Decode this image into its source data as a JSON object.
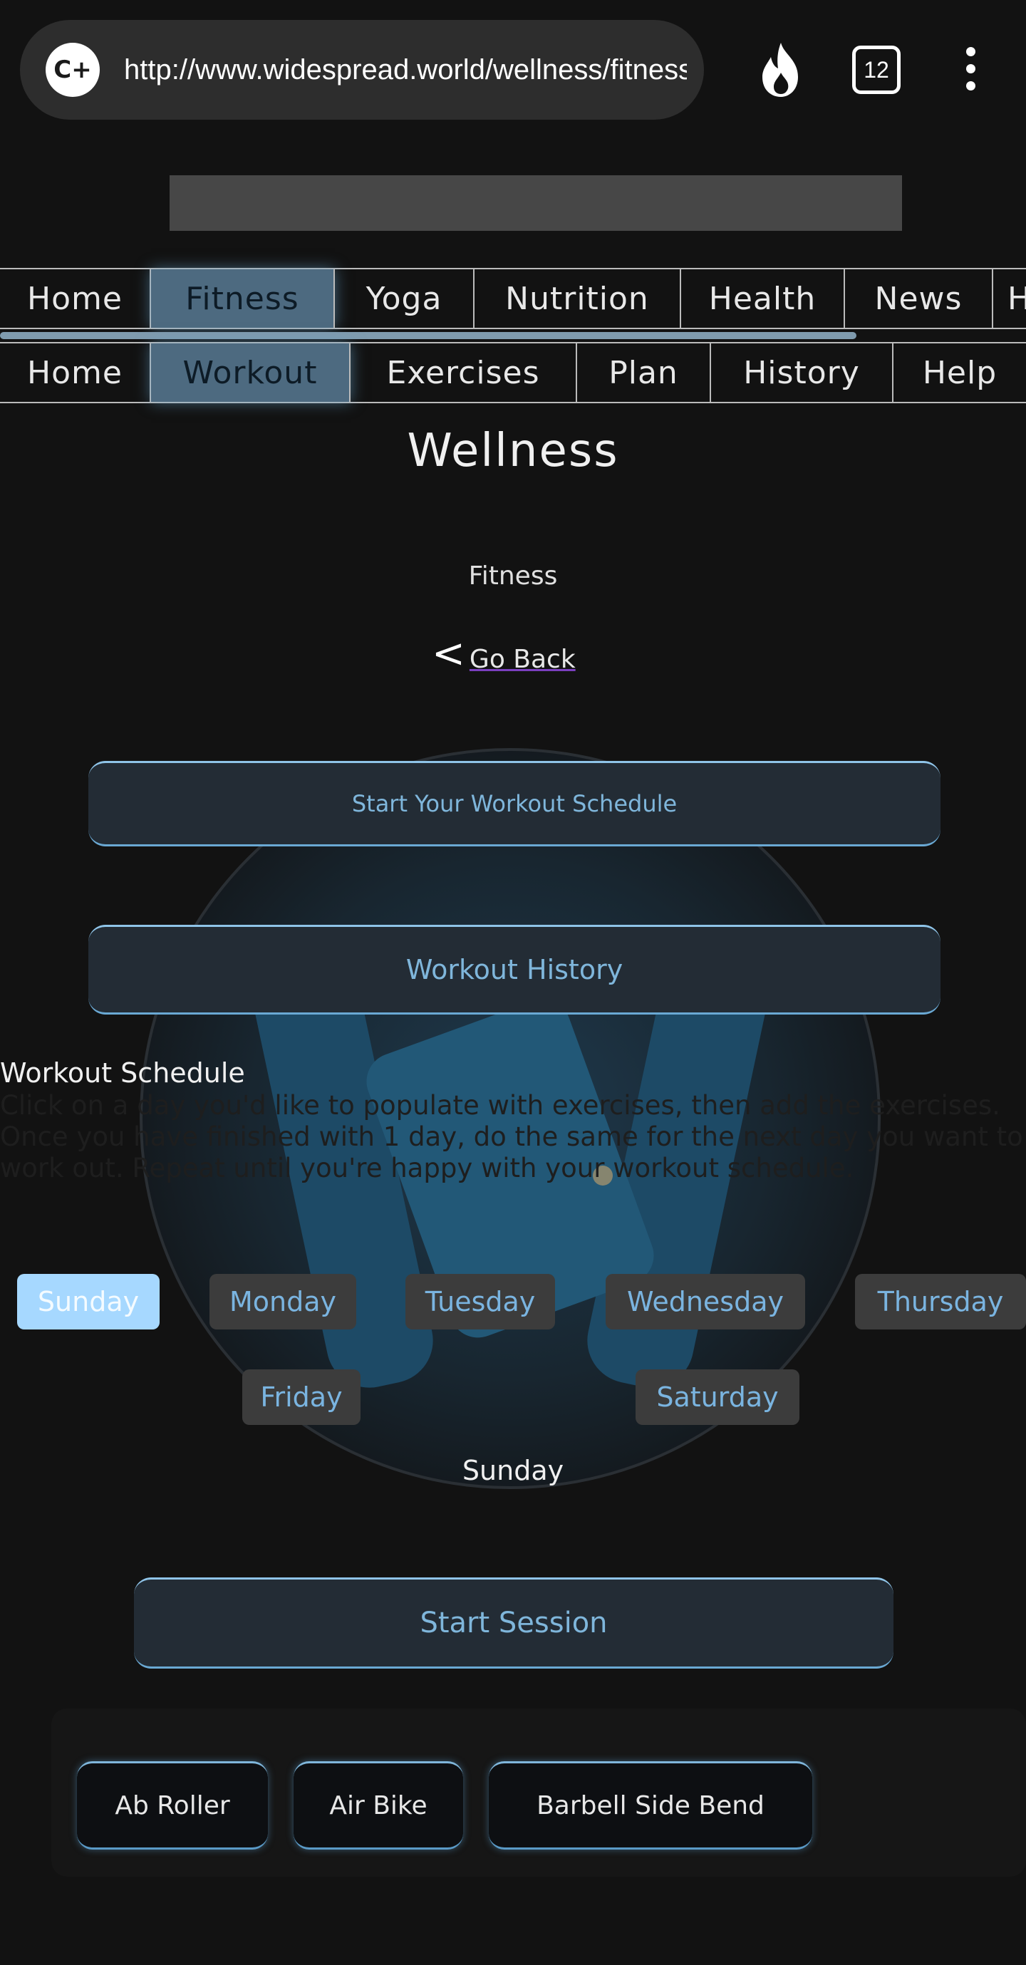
{
  "browser": {
    "url": "http://www.widespread.world/wellness/fitness",
    "tab_count": "12"
  },
  "top_nav": [
    {
      "label": "Home",
      "active": false
    },
    {
      "label": "Fitness",
      "active": true
    },
    {
      "label": "Yoga",
      "active": false
    },
    {
      "label": "Nutrition",
      "active": false
    },
    {
      "label": "Health",
      "active": false
    },
    {
      "label": "News",
      "active": false
    },
    {
      "label": "H",
      "active": false
    }
  ],
  "sub_nav": [
    {
      "label": "Home",
      "active": false
    },
    {
      "label": "Workout",
      "active": true
    },
    {
      "label": "Exercises",
      "active": false
    },
    {
      "label": "Plan",
      "active": false
    },
    {
      "label": "History",
      "active": false
    },
    {
      "label": "Help",
      "active": false
    }
  ],
  "page": {
    "title": "Wellness",
    "subtitle": "Fitness",
    "go_back": "Go Back",
    "start_schedule": "Start Your Workout Schedule",
    "workout_history": "Workout History"
  },
  "schedule": {
    "title": "Workout Schedule",
    "description": "Click on a day you'd like to populate with exercises, then add the exercises. Once you have finished with 1 day, do the same for the next day you want to work out. Repeat until you're happy with your workout schedule.",
    "days": [
      "Sunday",
      "Monday",
      "Tuesday",
      "Wednesday",
      "Thursday",
      "Friday",
      "Saturday"
    ],
    "selected_day": "Sunday",
    "start_session": "Start Session"
  },
  "exercises": [
    "Ab Roller",
    "Air Bike",
    "Barbell Side Bend"
  ],
  "colors": {
    "accent": "#7fb6db",
    "active_day": "#a6d8ff",
    "background": "#121212"
  }
}
